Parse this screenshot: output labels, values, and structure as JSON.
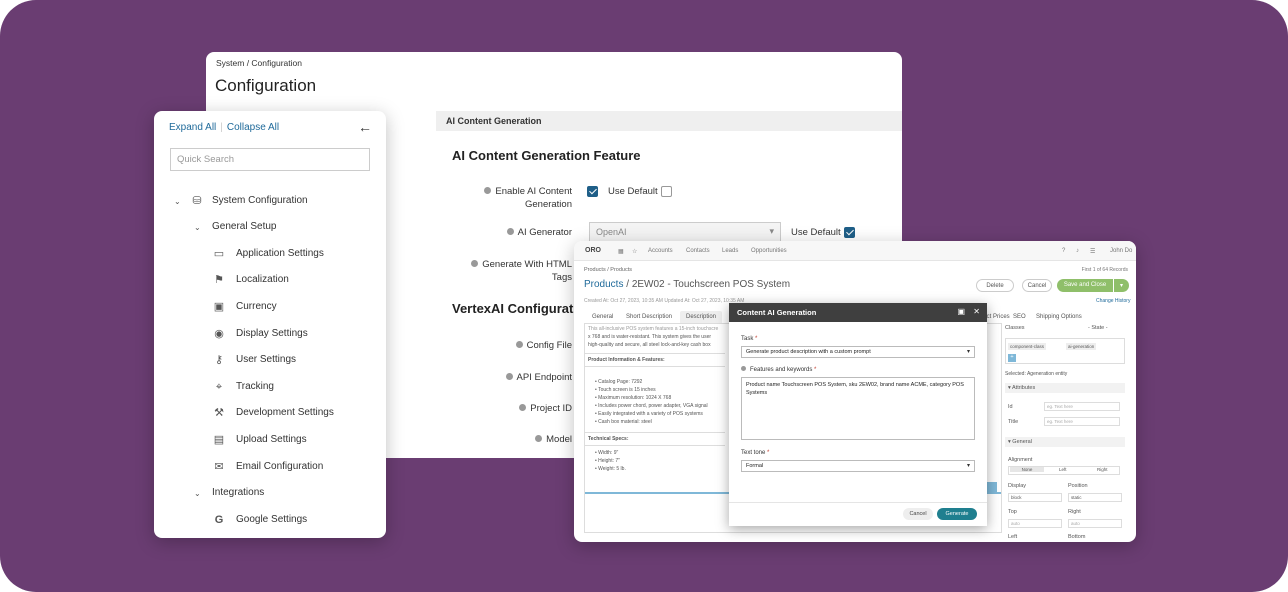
{
  "config": {
    "breadcrumb": "System / Configuration",
    "title": "Configuration",
    "section_header": "AI Content Generation",
    "feature_title": "AI Content Generation Feature",
    "rows": {
      "enable": "Enable AI Content Generation",
      "use_default": "Use Default",
      "ai_generator": "AI Generator",
      "ai_generator_value": "OpenAI",
      "html_tags": "Generate With HTML Tags"
    },
    "vertex_title": "VertexAI Configurat",
    "vertex_rows": [
      "Config File",
      "API Endpoint",
      "Project ID",
      "Model"
    ]
  },
  "sidebar": {
    "expand_all": "Expand All",
    "collapse_all": "Collapse All",
    "search_placeholder": "Quick Search",
    "items": [
      {
        "label": "System Configuration",
        "icon": "storage-icon"
      },
      {
        "label": "General Setup",
        "icon": ""
      },
      {
        "label": "Application Settings",
        "icon": "monitor-icon"
      },
      {
        "label": "Localization",
        "icon": "flag-icon"
      },
      {
        "label": "Currency",
        "icon": "money-icon"
      },
      {
        "label": "Display Settings",
        "icon": "eye-icon"
      },
      {
        "label": "User Settings",
        "icon": "user-key-icon"
      },
      {
        "label": "Tracking",
        "icon": "crosshair-icon"
      },
      {
        "label": "Development Settings",
        "icon": "wrench-icon"
      },
      {
        "label": "Upload Settings",
        "icon": "file-icon"
      },
      {
        "label": "Email Configuration",
        "icon": "envelope-icon"
      },
      {
        "label": "Integrations",
        "icon": ""
      },
      {
        "label": "Google Settings",
        "icon": "google-icon"
      }
    ]
  },
  "product": {
    "nav": {
      "logo": "ORO",
      "items": [
        "Accounts",
        "Contacts",
        "Leads",
        "Opportunities"
      ],
      "user": "John Do"
    },
    "breadcrumb": "Products / Products",
    "title_link": "Products",
    "title_rest": "2EW02 - Touchscreen POS System",
    "meta": "Created At: Oct 27, 2023, 10:35 AM   Updated At: Oct 27, 2023, 10:35 AM",
    "pager": "First   1 of 64 Records",
    "buttons": {
      "delete": "Delete",
      "cancel": "Cancel",
      "save": "Save and Close"
    },
    "change_history": "Change History",
    "tabs": [
      "General",
      "Short Description",
      "Description",
      "duct Prices",
      "SEO",
      "Shipping Options"
    ],
    "editor_lines": [
      "This all-inclusive POS system features a 15-inch touchscre",
      "x 768 and is water-resistant. This system gives the user",
      "high-quality and secure, all steel lock-and-key cash box",
      "Product Information & Features:",
      "Catalog Page: 7292",
      "Touch screen is 15 inches",
      "Maximum resolution: 1024 X 768",
      "Includes power chord, power adapter, VGA signal",
      "Easily integrated with a variety of POS systems",
      "Cash box material: steel",
      "Technical Specs:",
      "Width: 9\"",
      "Height: 7\"",
      "Weight: 5 lb."
    ],
    "right_panel": {
      "classes": "Classes",
      "state": "- State -",
      "tags": [
        "component-class",
        "ai-generation"
      ],
      "selected": "Selected:  Ageneration  entity",
      "attributes": "Attributes",
      "id_label": "Id",
      "title_label": "Title",
      "placeholder": "eg. Text here",
      "general": "General",
      "alignment": "Alignment",
      "align_opts": [
        "None",
        "Left",
        "Right"
      ],
      "display": "Display",
      "display_val": "block",
      "position": "Position",
      "position_val": "static",
      "top": "Top",
      "right": "Right",
      "auto": "auto",
      "left": "Left",
      "bottom": "Bottom"
    }
  },
  "modal": {
    "title": "Content AI Generation",
    "task_label": "Task",
    "task_value": "Generate product description with a custom prompt",
    "features_label": "Features and keywords",
    "features_value": "Product name Touchscreen POS System, sku 2EW02, brand name ACME, category POS Systems",
    "tone_label": "Text tone",
    "tone_value": "Formal",
    "cancel": "Cancel",
    "generate": "Generate"
  },
  "colors": {
    "background": "#6a3d72",
    "link": "#1f6a9a",
    "primary_button": "#1f7f8f",
    "save_button": "#8fbf6a"
  }
}
